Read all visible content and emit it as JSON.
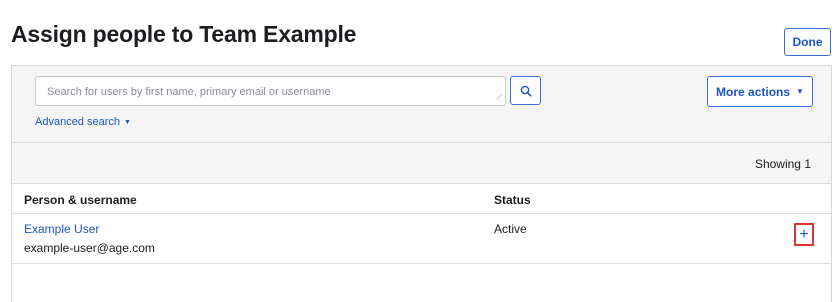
{
  "page": {
    "title": "Assign people to Team Example",
    "done_label": "Done"
  },
  "search": {
    "placeholder": "Search for users by first name, primary email or username",
    "value": "",
    "search_button_icon": "search-icon",
    "advanced_label": "Advanced search",
    "advanced_caret": "▼"
  },
  "actions": {
    "more_label": "More actions",
    "more_caret": "▼"
  },
  "results": {
    "showing_label": "Showing 1"
  },
  "table": {
    "columns": [
      "Person & username",
      "Status"
    ],
    "rows": [
      {
        "name": "Example User",
        "email": "example-user@age.com",
        "status": "Active",
        "action_icon": "plus-icon",
        "action_symbol": "+"
      }
    ]
  },
  "colors": {
    "link_blue": "#1c55c8",
    "button_border": "#3b6fd1",
    "highlight_red": "#e0332f",
    "toolbar_bg": "#f5f5f6"
  }
}
